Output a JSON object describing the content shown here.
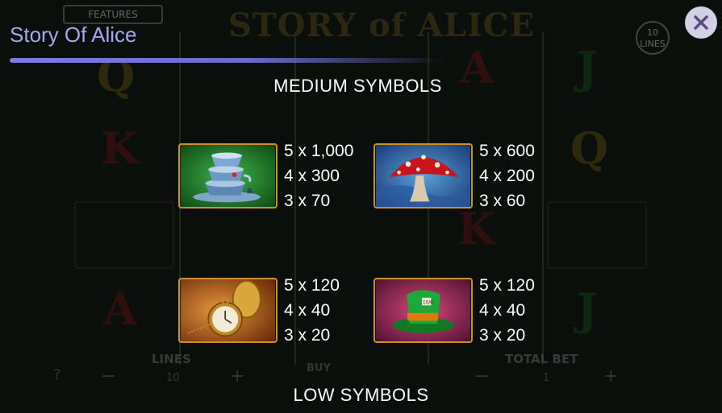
{
  "background": {
    "features_label": "FEATURES",
    "logo_text": "STORY of ALICE",
    "lines_badge": [
      "10",
      "LINES"
    ],
    "bottom": {
      "lines_label": "LINES",
      "lines_value": "10",
      "buy_label": "BUY",
      "total_bet_label": "TOTAL BET",
      "total_bet_value": "1",
      "minus": "−",
      "plus": "+",
      "help": "?"
    }
  },
  "header": {
    "title": "Story Of Alice",
    "close_icon": "close-icon"
  },
  "sections": {
    "medium_title": "MEDIUM SYMBOLS",
    "low_title": "LOW SYMBOLS"
  },
  "symbols": [
    {
      "name": "teacups",
      "pays": [
        "5 x 1,000",
        "4 x 300",
        "3 x 70"
      ]
    },
    {
      "name": "mushroom",
      "pays": [
        "5 x 600",
        "4 x 200",
        "3 x 60"
      ]
    },
    {
      "name": "pocket-watch",
      "pays": [
        "5 x 120",
        "4 x 40",
        "3 x 20"
      ]
    },
    {
      "name": "top-hat",
      "pays": [
        "5 x 120",
        "4 x 40",
        "3 x 20"
      ]
    }
  ],
  "colors": {
    "title": "#a4a8f0",
    "accent_bar": "#7d7de0",
    "tile_border": "#c9922e",
    "close_bg": "#d3d0e6",
    "close_x": "#5a4a86"
  }
}
